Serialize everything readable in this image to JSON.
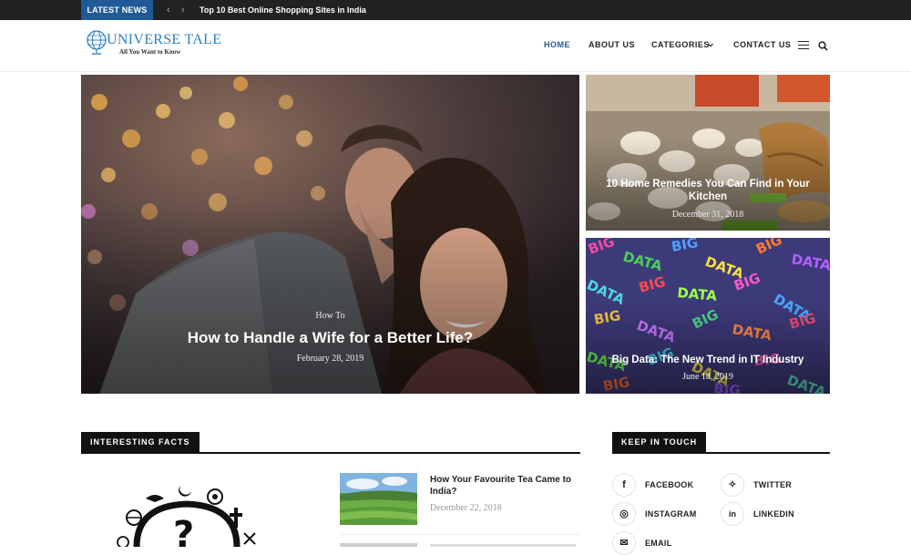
{
  "topbar": {
    "badge": "LATEST NEWS",
    "prev_icon": "chevron-left-icon",
    "next_icon": "chevron-right-icon",
    "headline": "Top 10 Best Online Shopping Sites in India"
  },
  "brand": {
    "title": "UNIVERSE TALE",
    "tagline": "All You Want to Know",
    "accent": "#1f5a97",
    "logo_color": "#2f7fc0"
  },
  "nav": {
    "items": [
      "HOME",
      "ABOUT US",
      "CATEGORIES",
      "CONTACT US"
    ],
    "active": "HOME",
    "dropdown_icon": "chevron-down-icon",
    "menu_icon": "hamburger-icon",
    "search_icon": "search-icon"
  },
  "featured": {
    "main": {
      "category": "How To",
      "title": "How to Handle a Wife for a Better Life?",
      "date": "February 28, 2019"
    },
    "slider": {
      "count": 5,
      "active_index": 0
    },
    "side": [
      {
        "title": "10 Home Remedies You Can Find in Your Kitchen",
        "date": "December 31, 2018"
      },
      {
        "title": "Big Data: The New Trend in IT Industry",
        "date": "June 18, 2019"
      }
    ]
  },
  "facts": {
    "heading": "INTERESTING FACTS",
    "post": {
      "title": "How Your Favourite Tea Came to India?",
      "date": "December 22, 2018"
    }
  },
  "touch": {
    "heading": "KEEP IN TOUCH",
    "items": [
      {
        "label": "FACEBOOK",
        "icon": "facebook-icon",
        "glyph": "f"
      },
      {
        "label": "TWITTER",
        "icon": "twitter-icon",
        "glyph": "✧"
      },
      {
        "label": "INSTAGRAM",
        "icon": "instagram-icon",
        "glyph": "◎"
      },
      {
        "label": "LINKEDIN",
        "icon": "linkedin-icon",
        "glyph": "in"
      },
      {
        "label": "EMAIL",
        "icon": "email-icon",
        "glyph": "✉"
      }
    ]
  }
}
